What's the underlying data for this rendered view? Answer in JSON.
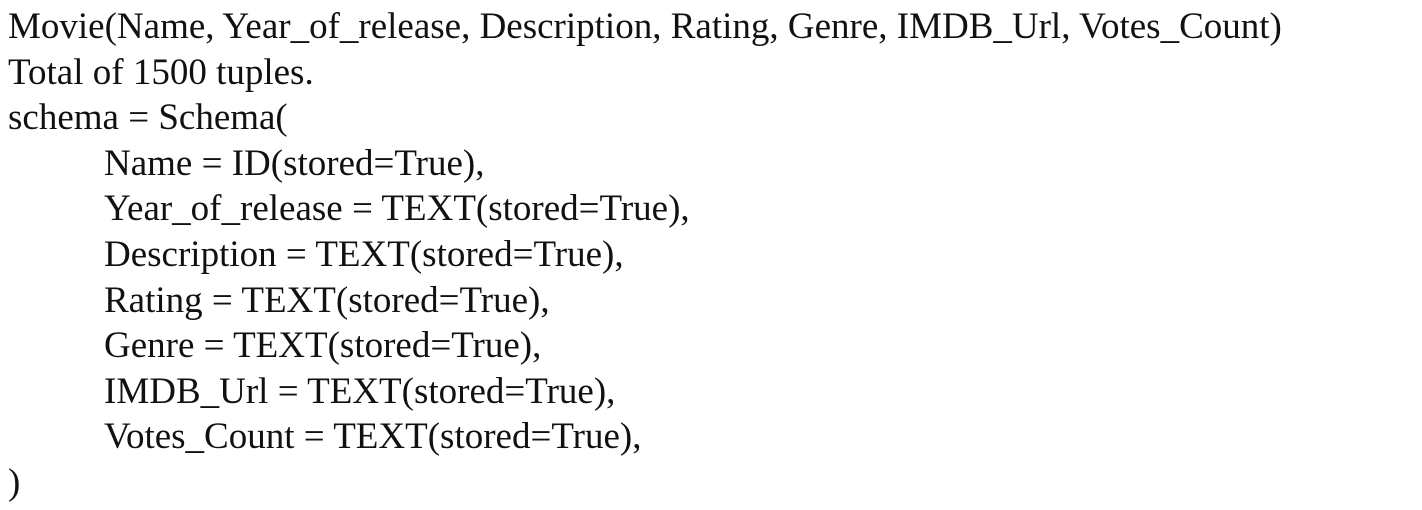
{
  "document": {
    "relation_header": "Movie(Name, Year_of_release, Description, Rating, Genre, IMDB_Url, Votes_Count)",
    "tuple_count": "Total of 1500 tuples.",
    "schema_open": "schema = Schema(",
    "fields": [
      "Name = ID(stored=True),",
      "Year_of_release = TEXT(stored=True),",
      "Description = TEXT(stored=True),",
      "Rating = TEXT(stored=True),",
      "Genre = TEXT(stored=True),",
      "IMDB_Url = TEXT(stored=True),",
      "Votes_Count = TEXT(stored=True),"
    ],
    "schema_close": ")"
  }
}
